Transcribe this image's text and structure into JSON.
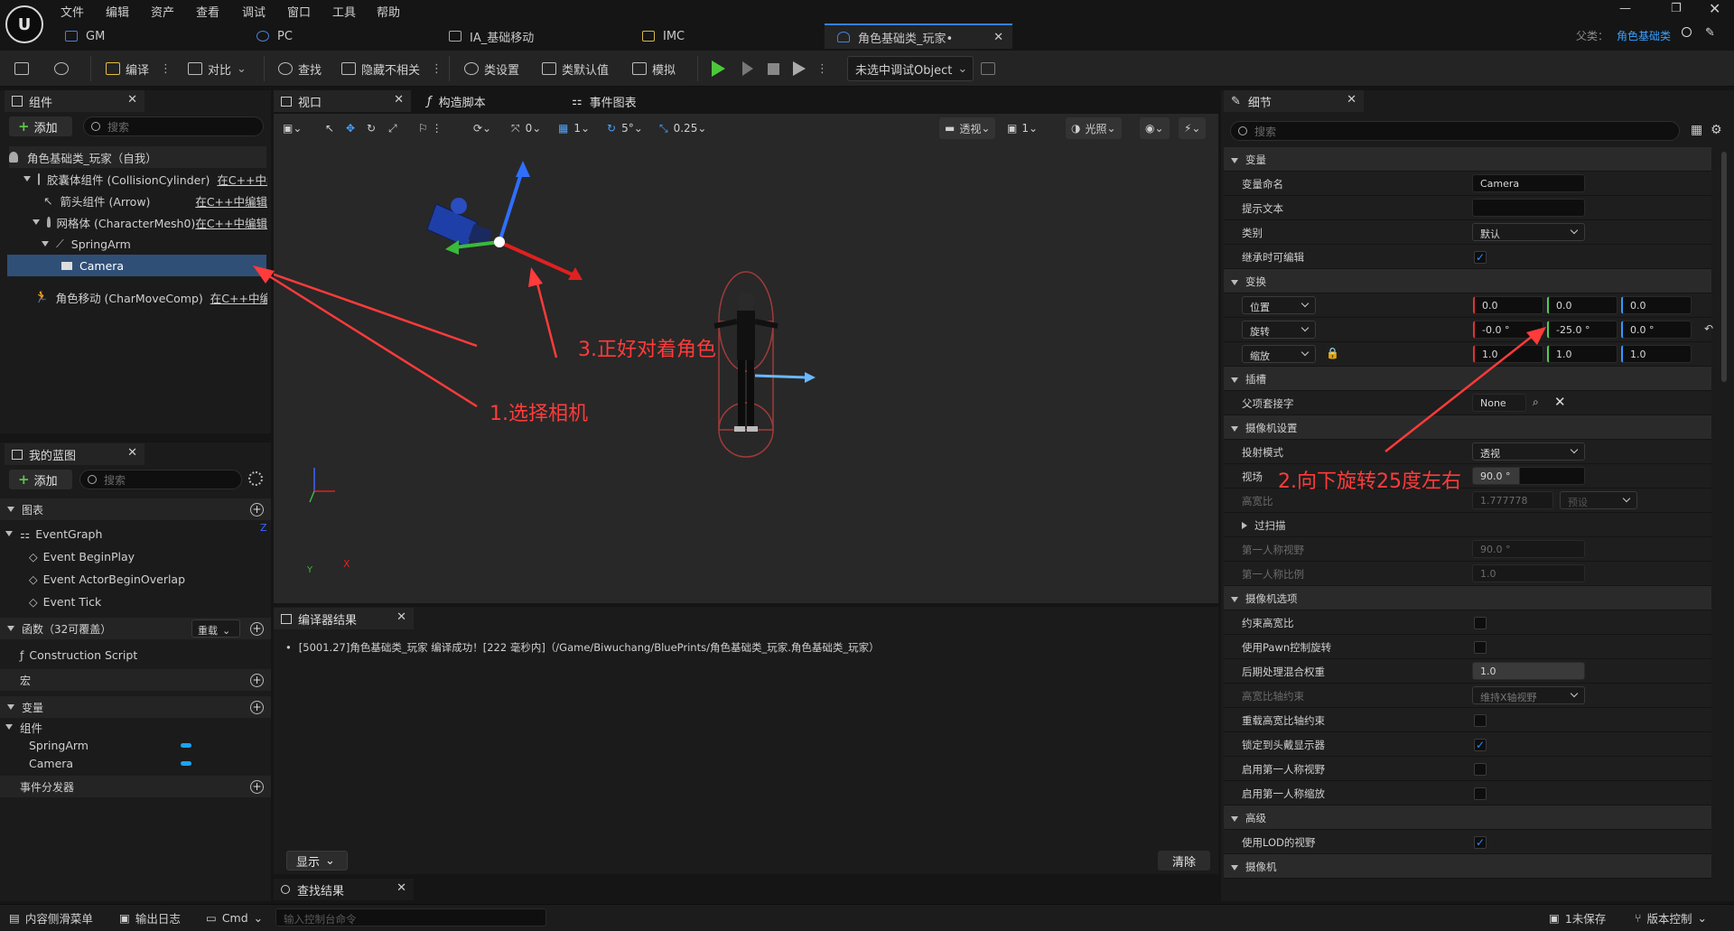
{
  "menu": [
    "文件",
    "编辑",
    "资产",
    "查看",
    "调试",
    "窗口",
    "工具",
    "帮助"
  ],
  "tabs": [
    {
      "label": "GM"
    },
    {
      "label": "PC"
    },
    {
      "label": "IA_基础移动"
    },
    {
      "label": "IMC"
    },
    {
      "label": "角色基础类_玩家•"
    }
  ],
  "parent": {
    "label": "父类：",
    "value": "角色基础类"
  },
  "toolbar": {
    "compile": "编译",
    "diff": "对比",
    "find": "查找",
    "hide_unrelated": "隐藏不相关",
    "class_settings": "类设置",
    "class_defaults": "类默认值",
    "simulate": "模拟",
    "debug_target": "未选中调试Object"
  },
  "components": {
    "tab": "组件",
    "add": "添加",
    "search_placeholder": "搜索",
    "items": [
      {
        "label": "角色基础类_玩家（自我）"
      },
      {
        "label": "胶囊体组件 (CollisionCylinder)",
        "link": "在C++中编"
      },
      {
        "label": "箭头组件 (Arrow)",
        "link": "在C++中编辑"
      },
      {
        "label": "网格体 (CharacterMesh0)",
        "link": "在C++中编辑"
      },
      {
        "label": "SpringArm"
      },
      {
        "label": "Camera"
      },
      {
        "label": "角色移动 (CharMoveComp)",
        "link": "在C++中编辑"
      }
    ]
  },
  "myblueprint": {
    "tab": "我的蓝图",
    "add": "添加",
    "search_placeholder": "搜索",
    "graphs_header": "图表",
    "event_graph": "EventGraph",
    "events": [
      "Event BeginPlay",
      "Event ActorBeginOverlap",
      "Event Tick"
    ],
    "functions_header": "函数（32可覆盖）",
    "override": "重载",
    "construction": "Construction Script",
    "macros_header": "宏",
    "variables_header": "变量",
    "components_header": "组件",
    "vars": [
      "SpringArm",
      "Camera"
    ],
    "dispatchers_header": "事件分发器"
  },
  "editor_tabs": {
    "viewport": "视口",
    "construction": "构造脚本",
    "event_graph": "事件图表"
  },
  "viewport_toolbar": {
    "rot": "0",
    "grid": "1",
    "angle": "5°",
    "scale": "0.25",
    "view": "透视",
    "cams": "1",
    "lit": "光照"
  },
  "axis": {
    "z": "Z",
    "x": "X",
    "y": "Y"
  },
  "annotations": {
    "a1": "1.选择相机",
    "a2": "2.向下旋转25度左右",
    "a3": "3.正好对着角色"
  },
  "compiler": {
    "tab": "编译器结果",
    "message": "[5001.27]角色基础类_玩家 编译成功！[222 毫秒内]（/Game/Biwuchang/BluePrints/角色基础类_玩家.角色基础类_玩家）",
    "show": "显示",
    "clear": "清除",
    "find_tab": "查找结果"
  },
  "details": {
    "tab": "细节",
    "search_placeholder": "搜索",
    "sec_variable": "变量",
    "var_name_label": "变量命名",
    "var_name": "Camera",
    "tooltip_label": "提示文本",
    "category_label": "类别",
    "category": "默认",
    "instance_editable": "继承时可编辑",
    "sec_transform": "变换",
    "location": "位置",
    "loc": [
      "0.0",
      "0.0",
      "0.0"
    ],
    "rotation": "旋转",
    "rot": [
      "-0.0 °",
      "-25.0 °",
      "0.0 °"
    ],
    "scale": "缩放",
    "scl": [
      "1.0",
      "1.0",
      "1.0"
    ],
    "sec_sockets": "插槽",
    "parent_socket": "父项套接字",
    "socket_value": "None",
    "sec_camera": "摄像机设置",
    "projection": "投射模式",
    "projection_value": "透视",
    "fov": "视场",
    "fov_value": "90.0 °",
    "aspect": "高宽比",
    "aspect_value": "1.777778",
    "aspect_preset": "预设",
    "overscan": "过扫描",
    "fp_fov": "第一人称视野",
    "fp_fov_value": "90.0 °",
    "fp_scale": "第一人称比例",
    "fp_scale_value": "1.0",
    "sec_camera_options": "摄像机选项",
    "constrain_aspect": "约束高宽比",
    "use_pawn_control": "使用Pawn控制旋转",
    "pp_blend": "后期处理混合权重",
    "pp_blend_value": "1.0",
    "aspect_axis": "高宽比轴约束",
    "aspect_axis_value": "维持X轴视野",
    "override_aspect": "重载高宽比轴约束",
    "lock_hmd": "锁定到头戴显示器",
    "enable_fp_fov": "启用第一人称视野",
    "enable_fp_scale": "启用第一人称缩放",
    "sec_advanced": "高级",
    "use_lod": "使用LOD的视野",
    "sec_camera2": "摄像机"
  },
  "status": {
    "content_drawer": "内容侧滑菜单",
    "output_log": "输出日志",
    "cmd": "Cmd",
    "console_placeholder": "输入控制台命令",
    "unsaved": "1未保存",
    "source_control": "版本控制"
  }
}
